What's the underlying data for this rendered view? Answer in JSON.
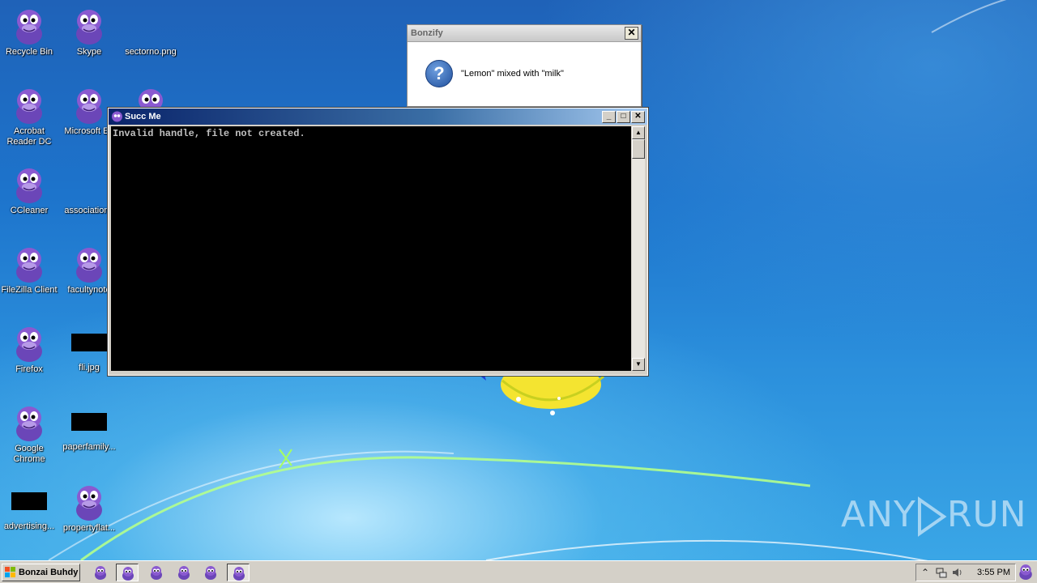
{
  "desktop": {
    "icons": [
      {
        "label": "Recycle Bin"
      },
      {
        "label": "Skype"
      },
      {
        "label": "sectorno.png"
      },
      {
        "label": "Acrobat Reader DC"
      },
      {
        "label": "Microsoft Ed"
      },
      {
        "label": "CCleaner"
      },
      {
        "label": "associationn"
      },
      {
        "label": "FileZilla Client"
      },
      {
        "label": "facultynote"
      },
      {
        "label": "Firefox"
      },
      {
        "label": "fli.jpg"
      },
      {
        "label": "Google Chrome"
      },
      {
        "label": "paperfamily..."
      },
      {
        "label": "advertising..."
      },
      {
        "label": "propertyflat..."
      }
    ],
    "watermark": {
      "left": "ANY",
      "right": "RUN"
    }
  },
  "dialog": {
    "title": "Bonzify",
    "close_label": "✕",
    "icon": "question-icon",
    "message": "\"Lemon\" mixed with \"milk\""
  },
  "console": {
    "title": "Succ Me",
    "output": "Invalid handle, file not created.",
    "minimize_label": "_",
    "maximize_label": "□",
    "close_label": "✕"
  },
  "taskbar": {
    "start_label": "Bonzai Buhdy",
    "clock": "3:55 PM",
    "tray_icons": [
      "chevron-up-icon",
      "network-icon",
      "volume-icon"
    ]
  },
  "colors": {
    "titlebar_active": "#0a246a",
    "desktop_blue": "#1d74cc",
    "bonzi_purple": "#8a5ad0"
  }
}
